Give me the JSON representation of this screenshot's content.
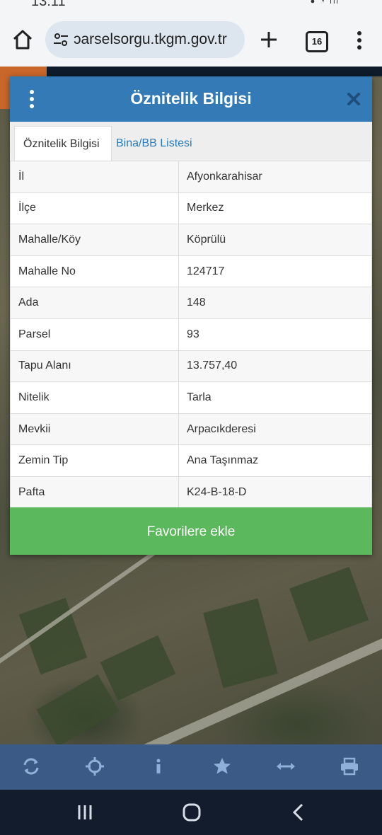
{
  "status_bar": {
    "time": "13:11"
  },
  "browser": {
    "url": "ɔarselsorgu.tkgm.gov.tr",
    "tab_count": "16"
  },
  "dialog": {
    "title": "Öznitelik Bilgisi",
    "tabs": [
      {
        "label": "Öznitelik Bilgisi",
        "active": true
      },
      {
        "label": "Bina/BB Listesi",
        "active": false
      }
    ],
    "rows": [
      {
        "key": "İl",
        "value": "Afyonkarahisar"
      },
      {
        "key": "İlçe",
        "value": "Merkez"
      },
      {
        "key": "Mahalle/Köy",
        "value": "Köprülü"
      },
      {
        "key": "Mahalle No",
        "value": "124717"
      },
      {
        "key": "Ada",
        "value": "148"
      },
      {
        "key": "Parsel",
        "value": "93"
      },
      {
        "key": "Tapu Alanı",
        "value": "13.757,40"
      },
      {
        "key": "Nitelik",
        "value": "Tarla"
      },
      {
        "key": "Mevkii",
        "value": "Arpacıkderesi"
      },
      {
        "key": "Zemin Tip",
        "value": "Ana Taşınmaz"
      },
      {
        "key": "Pafta",
        "value": "K24-B-18-D"
      }
    ],
    "favorite_label": "Favorilere ekle"
  },
  "toolbar": {
    "icons": [
      "refresh-icon",
      "locate-icon",
      "info-icon",
      "star-icon",
      "measure-icon",
      "print-icon"
    ]
  },
  "colors": {
    "header": "#337ab7",
    "favorite": "#5cb85c",
    "toolbar": "#3b5a86",
    "navbar": "#121c2c"
  }
}
